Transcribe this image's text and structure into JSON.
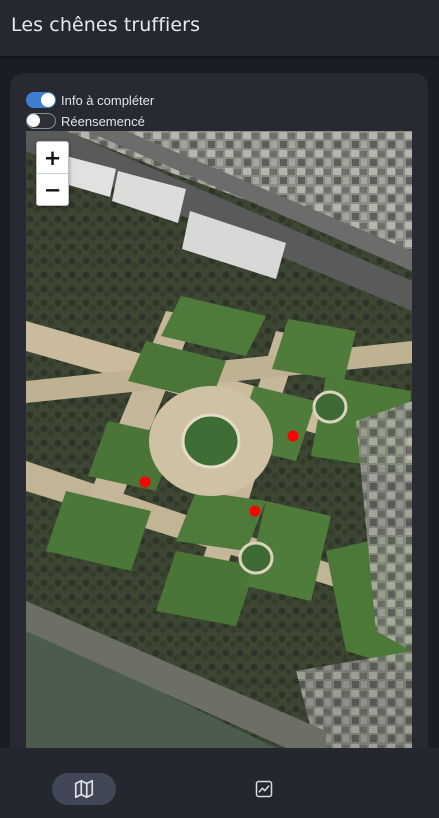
{
  "app": {
    "title": "Les chênes truffiers"
  },
  "filters": {
    "info_a_completer": {
      "label": "Info à compléter",
      "checked": true
    },
    "reensemence": {
      "label": "Réensemencé",
      "checked": false
    }
  },
  "map": {
    "zoom_in_label": "+",
    "zoom_out_label": "−",
    "layer": "satellite",
    "marker_color": "#ff0000",
    "markers": [
      {
        "name": "tree-marker-1"
      },
      {
        "name": "tree-marker-2"
      },
      {
        "name": "tree-marker-3"
      }
    ]
  },
  "bottom_nav": {
    "items": [
      {
        "icon": "map-icon",
        "active": true
      },
      {
        "icon": "image-chart-icon",
        "active": false
      }
    ]
  },
  "colors": {
    "accent": "#3f7fcf",
    "background": "#1b1d24",
    "card": "#272a32",
    "nav_active": "#414756"
  }
}
